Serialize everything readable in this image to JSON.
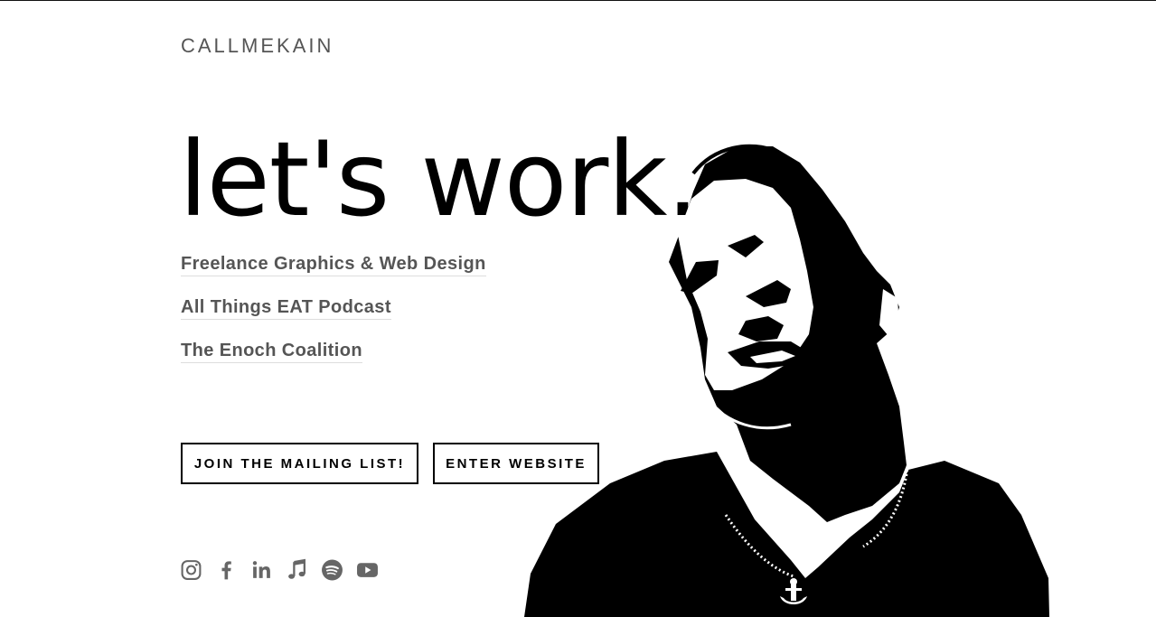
{
  "site": {
    "brand": "CALLMEKAIN"
  },
  "hero": {
    "headline": "let's work."
  },
  "links": [
    {
      "label": "Freelance Graphics & Web Design"
    },
    {
      "label": "All Things EAT Podcast"
    },
    {
      "label": "The Enoch Coalition"
    }
  ],
  "buttons": {
    "mailing": "JOIN THE MAILING LIST!",
    "enter": "ENTER WEBSITE"
  },
  "social": [
    {
      "icon": "instagram-icon"
    },
    {
      "icon": "facebook-icon"
    },
    {
      "icon": "linkedin-icon"
    },
    {
      "icon": "apple-music-icon"
    },
    {
      "icon": "spotify-icon"
    },
    {
      "icon": "youtube-icon"
    }
  ],
  "colors": {
    "text": "#000000",
    "muted": "#555555",
    "icon": "#666666",
    "background": "#ffffff"
  }
}
